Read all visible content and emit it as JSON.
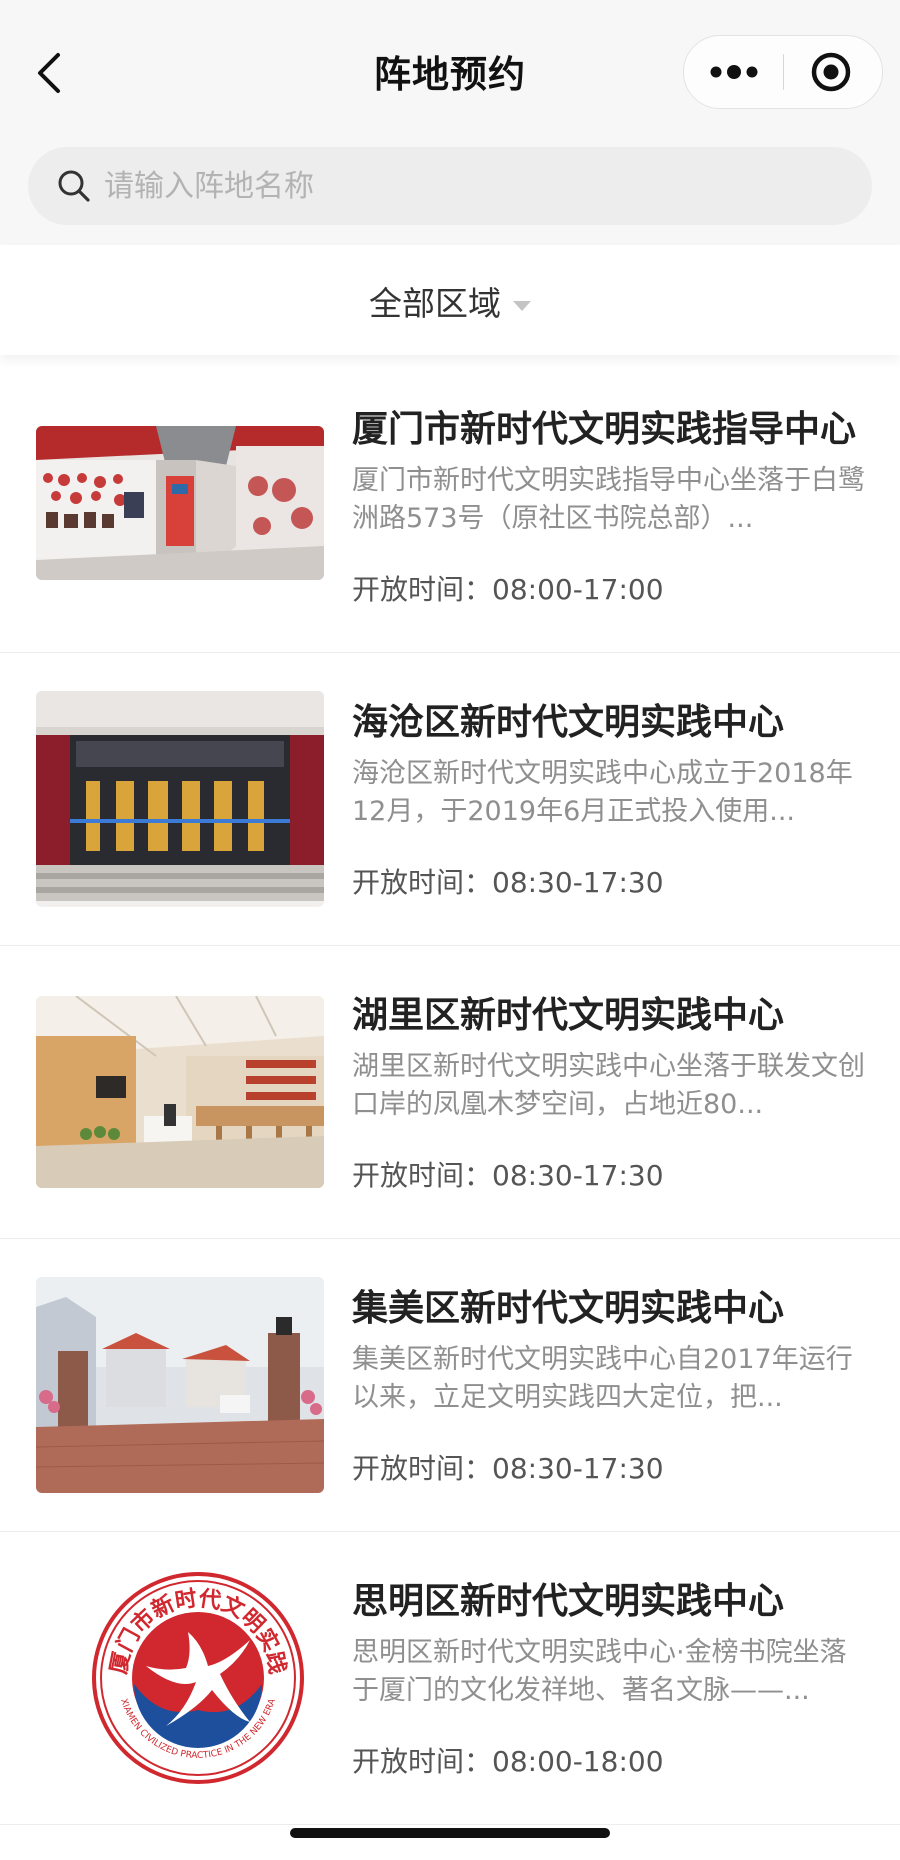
{
  "header": {
    "title": "阵地预约",
    "back_icon": "chevron-left-icon",
    "more_icon": "more-dots-icon",
    "close_icon": "target-close-icon"
  },
  "search": {
    "placeholder": "请输入阵地名称",
    "value": ""
  },
  "filter": {
    "region_label": "全部区域"
  },
  "hours_prefix": "开放时间：",
  "items": [
    {
      "title": "厦门市新时代文明实践指导中心",
      "desc": "厦门市新时代文明实践指导中心坐落于白鹭洲路573号（原社区书院总部）...",
      "hours": "08:00-17:00",
      "image": "exhibition-hall-image"
    },
    {
      "title": "海沧区新时代文明实践中心",
      "desc": "海沧区新时代文明实践中心成立于2018年12月，于2019年6月正式投入使用...",
      "hours": "08:30-17:30",
      "image": "building-entrance-image"
    },
    {
      "title": "湖里区新时代文明实践中心",
      "desc": "湖里区新时代文明实践中心坐落于联发文创口岸的凤凰木梦空间，占地近80...",
      "hours": "08:30-17:30",
      "image": "interior-space-image"
    },
    {
      "title": "集美区新时代文明实践中心",
      "desc": "集美区新时代文明实践中心自2017年运行以来，立足文明实践四大定位，把...",
      "hours": "08:30-17:30",
      "image": "courtyard-gate-image"
    },
    {
      "title": "思明区新时代文明实践中心",
      "desc": "思明区新时代文明实践中心·金榜书院坐落于厦门的文化发祥地、著名文脉——...",
      "hours": "08:00-18:00",
      "image": "civilized-practice-logo",
      "logo_text_cn": "厦门市新时代文明实践",
      "logo_text_en": "XIAMEN CIVILIZED PRACTICE IN THE NEW ERA"
    }
  ],
  "colors": {
    "logo_red": "#d0282e",
    "logo_blue": "#1d4f9c"
  }
}
